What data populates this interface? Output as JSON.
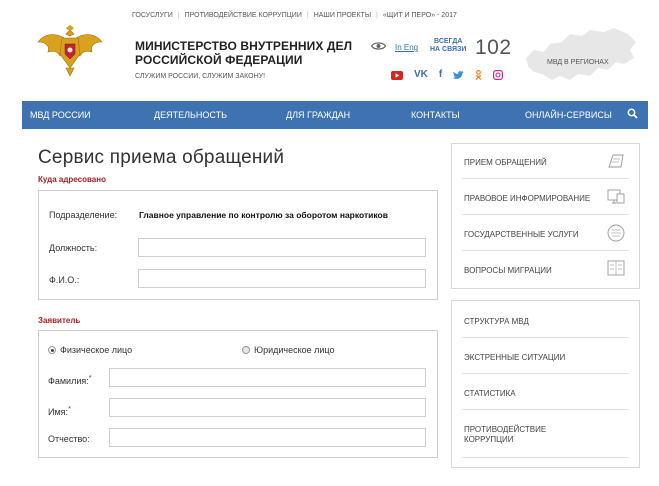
{
  "header": {
    "top_links": [
      "ГОСУСЛУГИ",
      "ПРОТИВОДЕЙСТВИЕ КОРРУПЦИИ",
      "НАШИ ПРОЕКТЫ",
      "«ЩИТ И ПЕРО» - 2017"
    ],
    "ministry_line1": "МИНИСТЕРСТВО ВНУТРЕННИХ ДЕЛ",
    "ministry_line2": "РОССИЙСКОЙ ФЕДЕРАЦИИ",
    "motto": "СЛУЖИМ РОССИИ, СЛУЖИМ ЗАКОНУ!",
    "lang_link": "In Eng",
    "contact_line1": "ВСЕГДА",
    "contact_line2": "НА СВЯЗИ",
    "phone": "102",
    "regions_label": "МВД В РЕГИОНАХ",
    "socials": [
      "youtube-icon",
      "vk-icon",
      "facebook-icon",
      "twitter-icon",
      "odnoklassniki-icon",
      "instagram-icon"
    ]
  },
  "nav": {
    "items": [
      "МВД РОССИИ",
      "ДЕЯТЕЛЬНОСТЬ",
      "ДЛЯ ГРАЖДАН",
      "КОНТАКТЫ",
      "ОНЛАЙН-СЕРВИСЫ"
    ],
    "search_icon": "search-icon"
  },
  "main": {
    "title": "Сервис приема обращений",
    "addressee": {
      "heading": "Куда адресовано",
      "division_label": "Подразделение:",
      "division_value": "Главное управление по контролю за оборотом наркотиков",
      "position_label": "Должность:",
      "position_value": "",
      "fio_label": "Ф.И.О.:",
      "fio_value": ""
    },
    "applicant": {
      "heading": "Заявитель",
      "radio_individual": "Физическое лицо",
      "radio_legal": "Юридическое лицо",
      "individual_selected": true,
      "surname_label": "Фамилия:",
      "name_label": "Имя:",
      "patronymic_label": "Отчество:",
      "required_mark": "*",
      "surname_value": "",
      "name_value": "",
      "patronymic_value": ""
    }
  },
  "sidebar": {
    "group1": [
      "ПРИЕМ ОБРАЩЕНИЙ",
      "ПРАВОВОЕ ИНФОРМИРОВАНИЕ",
      "ГОСУДАРСТВЕННЫЕ УСЛУГИ",
      "ВОПРОСЫ МИГРАЦИИ"
    ],
    "group2": [
      "СТРУКТУРА МВД",
      "ЭКСТРЕННЫЕ СИТУАЦИИ",
      "СТАТИСТИКА",
      "ПРОТИВОДЕЙСТВИЕ",
      "КОРРУПЦИИ"
    ]
  },
  "colors": {
    "nav_bg": "#3f72b0",
    "section_heading": "#a02323",
    "link": "#3d6fb0"
  }
}
